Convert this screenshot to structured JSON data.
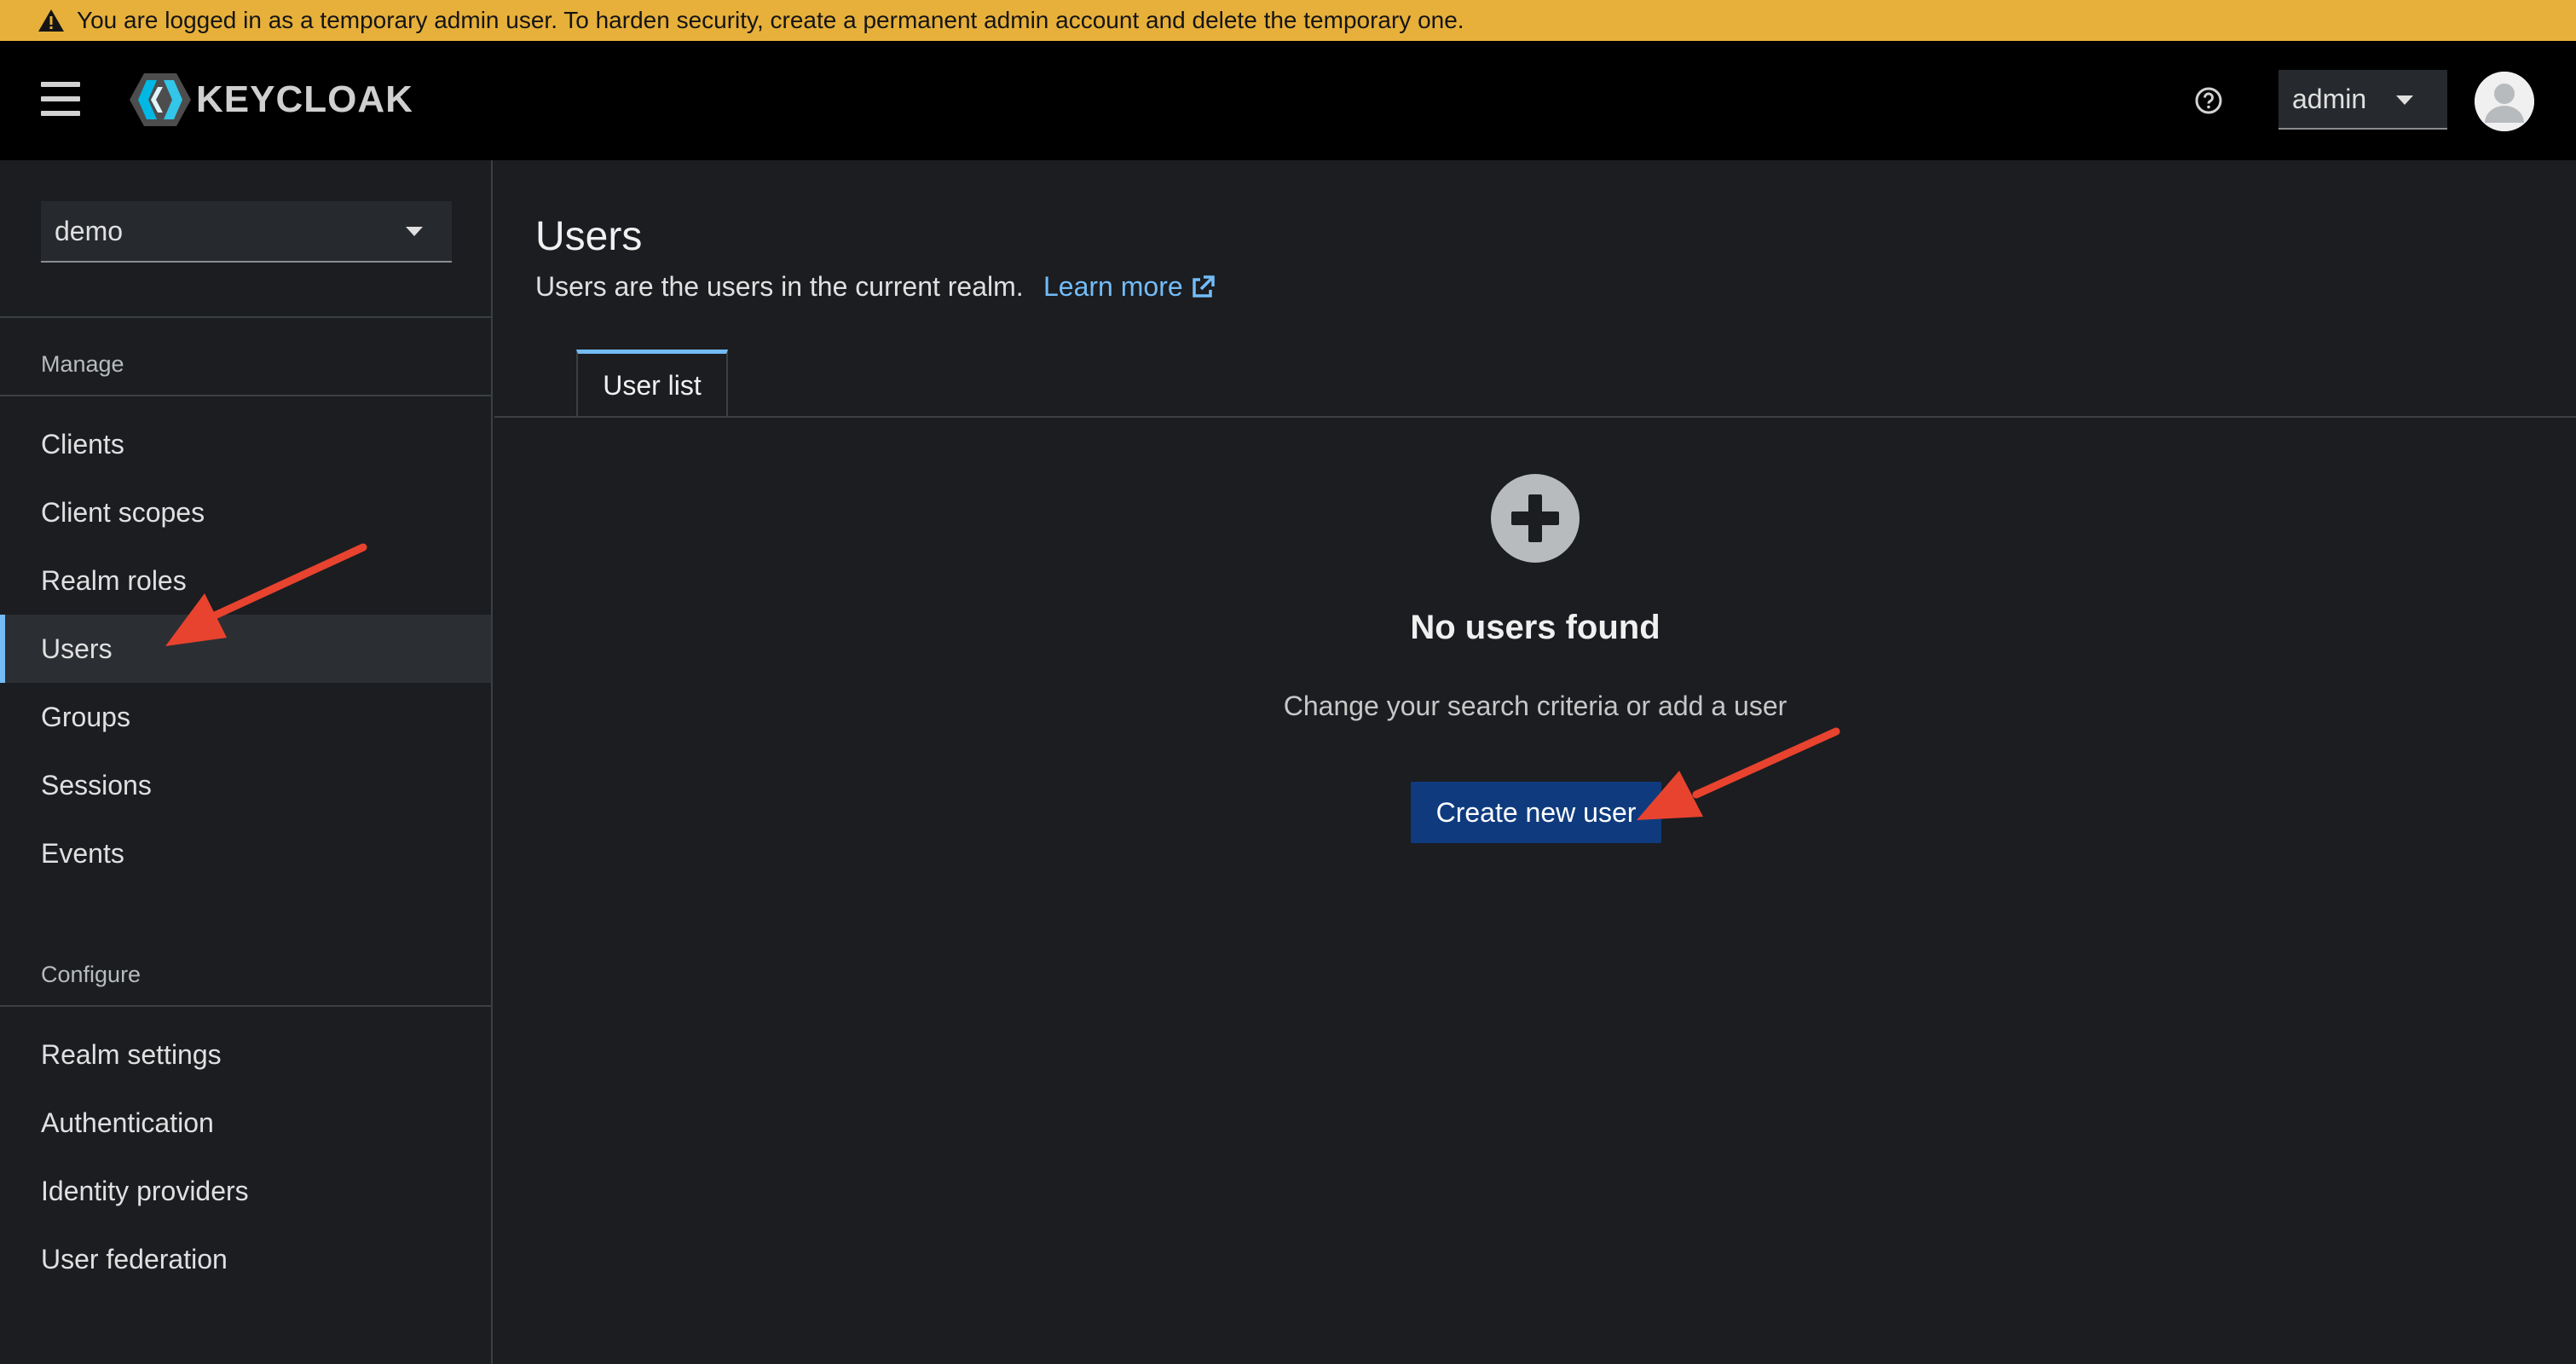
{
  "banner": {
    "text": "You are logged in as a temporary admin user. To harden security, create a permanent admin account and delete the temporary one.",
    "icon": "warning-icon",
    "color": "#e7b03a"
  },
  "masthead": {
    "logo_text": "KEYCLOAK",
    "user_menu_label": "admin",
    "icons": [
      "menu-icon",
      "help-icon",
      "avatar-icon"
    ]
  },
  "sidebar": {
    "realm": "demo",
    "manage_title": "Manage",
    "manage_items": [
      "Clients",
      "Client scopes",
      "Realm roles",
      "Users",
      "Groups",
      "Sessions",
      "Events"
    ],
    "configure_title": "Configure",
    "configure_items": [
      "Realm settings",
      "Authentication",
      "Identity providers",
      "User federation"
    ],
    "active_item": "Users"
  },
  "main": {
    "title": "Users",
    "description": "Users are the users in the current realm.",
    "learn_more": "Learn more",
    "tabs": [
      "User list"
    ],
    "empty_state": {
      "title": "No users found",
      "body": "Change your search criteria or add a user",
      "button": "Create new user"
    }
  },
  "colors": {
    "accent": "#73bcf7",
    "primary_button": "#0f3b7e",
    "annotation_arrow": "#e8432e"
  }
}
